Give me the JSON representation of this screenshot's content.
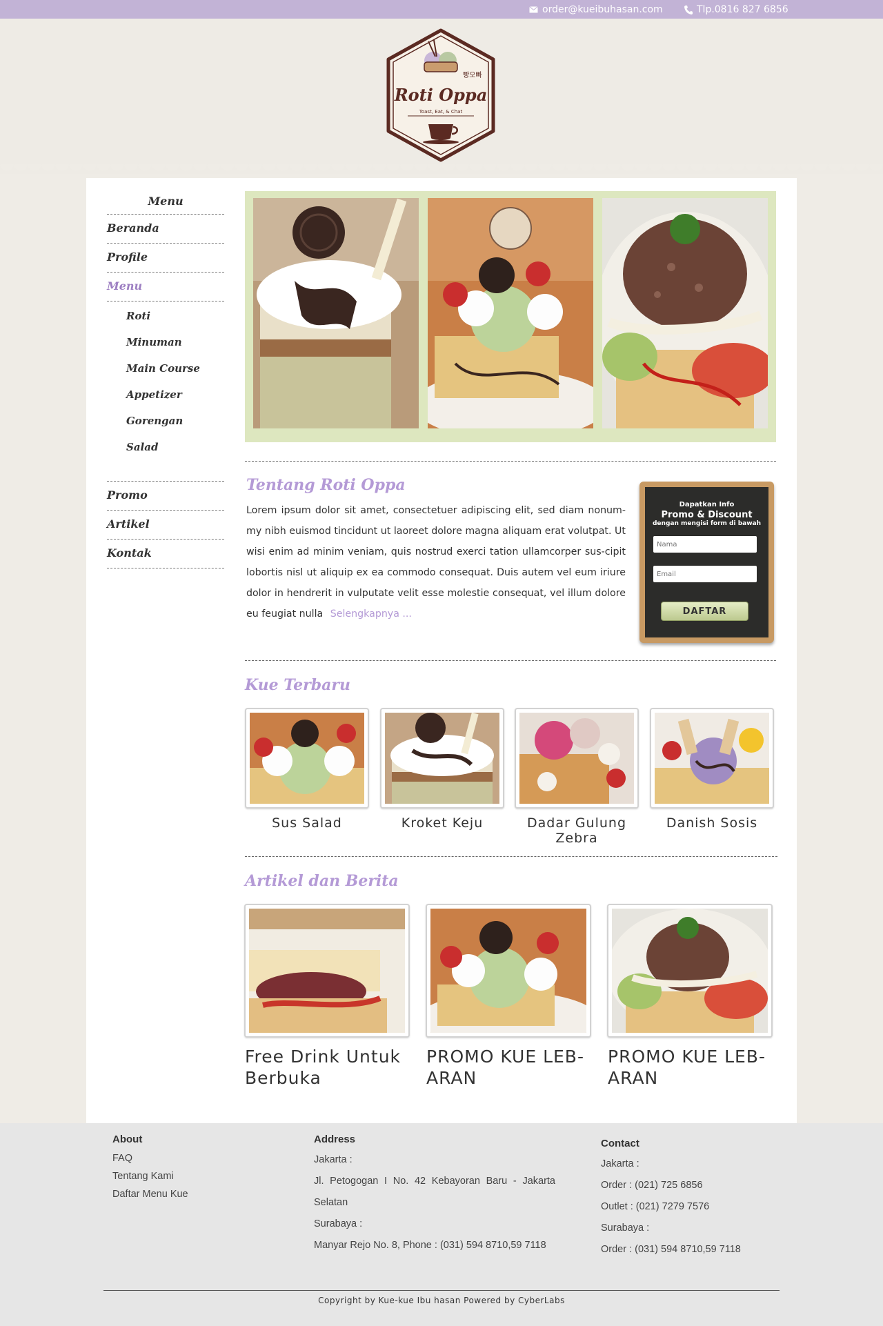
{
  "topbar": {
    "email": "order@kueibuhasan.com",
    "phone": "Tlp.0816 827 6856"
  },
  "logo": {
    "brand": "Roti Oppa",
    "korean": "빵오빠",
    "tagline": "Toast, Eat, & Chat"
  },
  "sidebar": {
    "title": "Menu",
    "items": [
      {
        "label": "Beranda"
      },
      {
        "label": "Profile"
      },
      {
        "label": "Menu"
      }
    ],
    "subitems": [
      {
        "label": "Roti"
      },
      {
        "label": "Minuman"
      },
      {
        "label": "Main Course"
      },
      {
        "label": "Appetizer"
      },
      {
        "label": "Gorengan"
      },
      {
        "label": "Salad"
      }
    ],
    "bottom_items": [
      {
        "label": "Promo"
      },
      {
        "label": "Artikel"
      },
      {
        "label": "Kontak"
      }
    ]
  },
  "about": {
    "title": "Tentang Roti Oppa",
    "text": "Lorem ipsum dolor sit amet, consectetuer adipiscing elit, sed diam nonum-my nibh euismod tincidunt ut laoreet dolore magna aliquam erat volutpat. Ut wisi enim ad minim veniam, quis nostrud exerci tation ullamcorper sus-cipit lobortis nisl ut aliquip ex ea commodo consequat. Duis autem vel eum iriure dolor in hendrerit in vulputate velit esse molestie consequat, vel illum dolore eu feugiat nulla",
    "more": "Selengkapnya ..."
  },
  "signup": {
    "line1": "Dapatkan Info",
    "line2": "Promo & Discount",
    "line3": "dengan mengisi form di bawah",
    "name_placeholder": "Nama",
    "email_placeholder": "Email",
    "button": "DAFTAR"
  },
  "latest": {
    "title": "Kue Terbaru",
    "items": [
      {
        "caption": "Sus Salad"
      },
      {
        "caption": "Kroket Keju"
      },
      {
        "caption": "Dadar Gulung Zebra"
      },
      {
        "caption": "Danish Sosis"
      }
    ]
  },
  "articles": {
    "title": "Artikel dan Berita",
    "items": [
      {
        "caption": "Free Drink Untuk Berbuka"
      },
      {
        "caption": "PROMO KUE LEB-ARAN"
      },
      {
        "caption": "PROMO KUE LEB-ARAN"
      }
    ]
  },
  "footer": {
    "about": {
      "title": "About",
      "links": [
        "FAQ",
        "Tentang Kami",
        "Daftar Menu Kue"
      ]
    },
    "address": {
      "title": "Address",
      "lines": [
        "Jakarta :",
        "Jl. Petogogan I No. 42 Kebayoran Baru - Jakarta Selatan",
        "Surabaya :",
        "Manyar Rejo No. 8, Phone : (031) 594 8710,59 7118"
      ]
    },
    "contact": {
      "title": "Contact",
      "lines": [
        "Jakarta :",
        "Order : (021) 725 6856",
        "Outlet : (021) 7279 7576",
        "Surabaya  :",
        "Order : (031) 594 8710,59 7118"
      ]
    },
    "copyright": "Copyright by Kue-kue Ibu hasan Powered by CyberLabs"
  },
  "colors": {
    "topbar": "#c2b3d6",
    "accent": "#b49ad6",
    "slider_bg": "#dde7bf",
    "footer_bg": "#e6e6e6"
  }
}
